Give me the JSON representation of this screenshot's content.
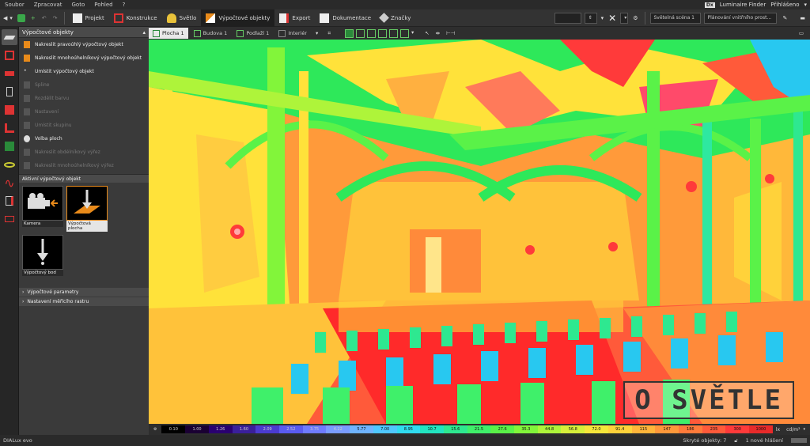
{
  "menu": [
    "Soubor",
    "Zpracovat",
    "Goto",
    "Pohled",
    "?"
  ],
  "topright": {
    "logo": "Dx",
    "finder": "Luminaire Finder",
    "login": "Přihlášeno"
  },
  "toolbar": {
    "tabs": [
      {
        "label": "Projekt",
        "active": false
      },
      {
        "label": "Konstrukce",
        "active": false
      },
      {
        "label": "Světlo",
        "active": false
      },
      {
        "label": "Výpočtové objekty",
        "active": true
      },
      {
        "label": "Export",
        "active": false
      },
      {
        "label": "Dokumentace",
        "active": false
      },
      {
        "label": "Značky",
        "active": false
      }
    ],
    "scene_dropdown": "Světelná scéna 1",
    "plan_dropdown": "Plánování vnitřního prost..."
  },
  "panel": {
    "title": "Výpočtové objekty",
    "items": [
      {
        "label": "Nakreslit pravoúhlý výpočtový objekt",
        "dim": false
      },
      {
        "label": "Nakreslit mnohoúhelníkový výpočtový objekt",
        "dim": false
      },
      {
        "label": "Umístit výpočtový objekt",
        "dim": false
      },
      {
        "label": "Spline",
        "dim": true
      },
      {
        "label": "Rozdělit barvu",
        "dim": true
      },
      {
        "label": "Nastavení",
        "dim": true
      },
      {
        "label": "Umístit skupinu",
        "dim": true
      },
      {
        "label": "Volba ploch",
        "dim": false
      },
      {
        "label": "Nakreslit obdélníkový výřez",
        "dim": true
      },
      {
        "label": "Nakreslit mnohoúhelníkový výřez",
        "dim": true
      }
    ],
    "active_title": "Aktivní výpočtový objekt",
    "thumbs": [
      {
        "label": "Kamera",
        "selected": false
      },
      {
        "label": "Výpočtová plocha",
        "selected": true
      },
      {
        "label": "Výpočtový bod",
        "selected": false
      }
    ],
    "sections": [
      "Výpočtové parametry",
      "Nastavení měřícího rastru"
    ]
  },
  "viewtabs": [
    {
      "label": "Plocha 1",
      "active": true
    },
    {
      "label": "Budova 1",
      "active": false
    },
    {
      "label": "Podlaží 1",
      "active": false
    },
    {
      "label": "Interiér",
      "active": false
    }
  ],
  "watermark": "O SVĚTLE",
  "legend": {
    "values": [
      "0.10",
      "1.00",
      "1.26",
      "1.60",
      "2.09",
      "2.52",
      "3.75",
      "4.22",
      "5.77",
      "7.00",
      "8.95",
      "10.7",
      "15.6",
      "21.5",
      "27.6",
      "35.3",
      "44.8",
      "56.8",
      "72.0",
      "91.4",
      "115",
      "147",
      "186",
      "235",
      "300",
      "1000"
    ],
    "colors": [
      "#000000",
      "#1a0033",
      "#2a0070",
      "#3a1f9a",
      "#4b3bd0",
      "#5a5bf0",
      "#6f7bff",
      "#7a9cff",
      "#6fb4ff",
      "#4fc8ff",
      "#30dcf0",
      "#22e4c0",
      "#2ee890",
      "#3ff06a",
      "#5af248",
      "#82f53a",
      "#aef43a",
      "#d6ef3a",
      "#f5e63a",
      "#ffd23a",
      "#ffb53a",
      "#ff983a",
      "#ff7a3a",
      "#ff5a3a",
      "#ff3a3a",
      "#e82a2a"
    ],
    "unit": "cd/m²"
  },
  "status": {
    "app": "DIALux evo",
    "hidden": "Skryté objekty: 7",
    "messages": "1 nové hlášení"
  },
  "colors": {
    "accent": "#e88a1a",
    "panel": "#3a3a3a",
    "dark": "#2a2a2a"
  }
}
